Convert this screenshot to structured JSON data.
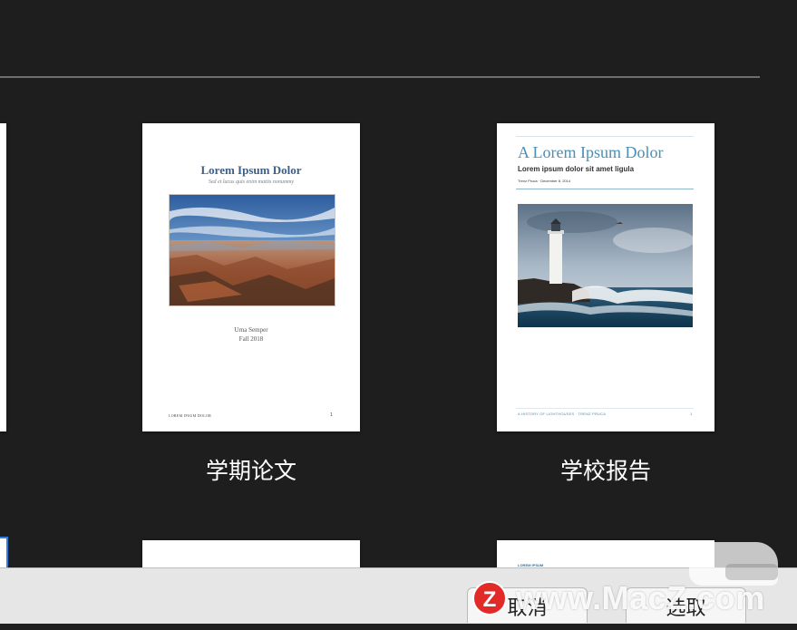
{
  "templates": [
    {
      "caption": "学期论文",
      "title": "Lorem Ipsum Dolor",
      "subtitle": "Sed et lacus quis enim mattis nonummy",
      "author": "Urna Semper",
      "date": "Fall 2018",
      "footer": "LOREM IPSUM DOLOR",
      "page": "1"
    },
    {
      "caption": "学校报告",
      "title": "A Lorem Ipsum Dolor",
      "subtitle": "Lorem ipsum dolor sit amet ligula",
      "byline": "Trenz Pruca · December 8, 2014",
      "footer": "A HISTORY OF LIGHTHOUSES · TRENZ PRUCA",
      "page": "1"
    },
    {
      "caption": ""
    },
    {
      "caption": "",
      "heading": "LOREM IPSUM"
    }
  ],
  "buttons": {
    "cancel": "取消",
    "choose": "选取"
  },
  "watermark": {
    "badge": "Z",
    "text": "www.MacZ.com"
  },
  "colors": {
    "background": "#1e1e1e",
    "accent_blue": "#4b8eb6",
    "watermark_red": "#e22a29"
  }
}
